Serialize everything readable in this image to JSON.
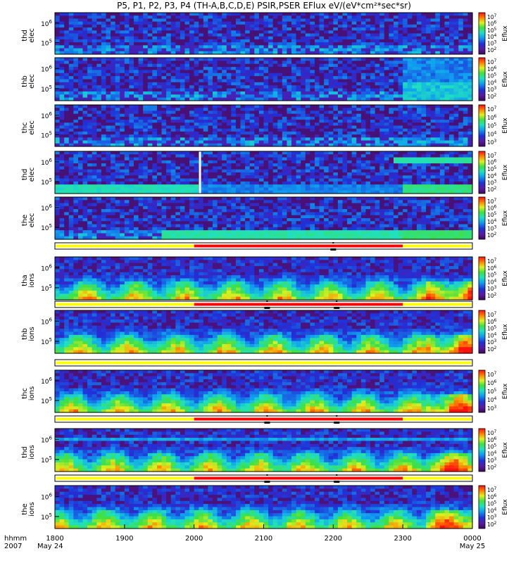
{
  "title": "P5, P1, P2, P3, P4 (TH-A,B,C,D,E) PSIR,PSER EFlux eV/(eV*cm²*sec*sr)",
  "chart_data": {
    "type": "heatmap",
    "title": "P5, P1, P2, P3, P4 (TH-A,B,C,D,E) PSIR,PSER EFlux eV/(eV*cm²*sec*sr)",
    "x_axis": {
      "label_line1": "hhmm",
      "label_line2": "2007",
      "ticks": [
        "1800",
        "1900",
        "2000",
        "2100",
        "2200",
        "2300",
        "0000"
      ],
      "date_labels": [
        "May 24",
        "May 25"
      ],
      "range": [
        "2007-05-24 18:00",
        "2007-05-25 00:00"
      ]
    },
    "colorbar": {
      "label": "Eflux",
      "scale": "log",
      "range": [
        100,
        10000000
      ],
      "tick_base": "10",
      "tick_exponents": [
        "7",
        "6",
        "5",
        "4",
        "3",
        "2"
      ]
    },
    "y_scale": "log",
    "panels": [
      {
        "id": "thd_elec",
        "probe": "thd",
        "species": "elec",
        "ylabel_line1": "thd",
        "ylabel_line2": "elec",
        "ytick_base": "10",
        "ytick_exponents": [
          "6",
          "5"
        ],
        "colorbar_exponents": [
          "7",
          "6",
          "5",
          "4",
          "3",
          "2"
        ]
      },
      {
        "id": "thb_elec",
        "probe": "thb",
        "species": "elec",
        "ylabel_line1": "thb",
        "ylabel_line2": "elec",
        "ytick_base": "10",
        "ytick_exponents": [
          "6",
          "5"
        ],
        "colorbar_exponents": [
          "7",
          "6",
          "5",
          "4",
          "3",
          "2"
        ]
      },
      {
        "id": "thc_elec",
        "probe": "thc",
        "species": "elec",
        "ylabel_line1": "thc",
        "ylabel_line2": "elec",
        "ytick_base": "10",
        "ytick_exponents": [
          "6",
          "5"
        ],
        "colorbar_exponents": [
          "7",
          "6",
          "5",
          "4",
          "3"
        ]
      },
      {
        "id": "thd_elec_2",
        "probe": "thd",
        "species": "elec",
        "ylabel_line1": "thd",
        "ylabel_line2": "elec",
        "ytick_base": "10",
        "ytick_exponents": [
          "6",
          "5"
        ],
        "colorbar_exponents": [
          "7",
          "6",
          "5",
          "4",
          "3",
          "2"
        ]
      },
      {
        "id": "the_elec",
        "probe": "the",
        "species": "elec",
        "ylabel_line1": "the",
        "ylabel_line2": "elec",
        "ytick_base": "10",
        "ytick_exponents": [
          "6",
          "5"
        ],
        "colorbar_exponents": [
          "7",
          "6",
          "5",
          "4",
          "3",
          "2"
        ]
      },
      {
        "id": "tha_ions",
        "probe": "tha",
        "species": "ions",
        "ylabel_line1": "tha",
        "ylabel_line2": "ions",
        "ytick_base": "10",
        "ytick_exponents": [
          "6",
          "5"
        ],
        "colorbar_exponents": [
          "7",
          "6",
          "5",
          "4",
          "3",
          "2"
        ]
      },
      {
        "id": "thb_ions",
        "probe": "thb",
        "species": "ions",
        "ylabel_line1": "thb",
        "ylabel_line2": "ions",
        "ytick_base": "10",
        "ytick_exponents": [
          "6",
          "5"
        ],
        "colorbar_exponents": [
          "7",
          "6",
          "5",
          "4",
          "3",
          "2"
        ]
      },
      {
        "id": "thc_ions",
        "probe": "thc",
        "species": "ions",
        "ylabel_line1": "thc",
        "ylabel_line2": "ions",
        "ytick_base": "10",
        "ytick_exponents": [
          "6",
          "5"
        ],
        "colorbar_exponents": [
          "7",
          "6",
          "5",
          "4",
          "3"
        ]
      },
      {
        "id": "thd_ions",
        "probe": "thd",
        "species": "ions",
        "ylabel_line1": "thd",
        "ylabel_line2": "ions",
        "ytick_base": "10",
        "ytick_exponents": [
          "6",
          "5"
        ],
        "colorbar_exponents": [
          "7",
          "6",
          "5",
          "4",
          "3",
          "2"
        ]
      },
      {
        "id": "the_ions",
        "probe": "the",
        "species": "ions",
        "ylabel_line1": "the",
        "ylabel_line2": "ions",
        "ytick_base": "10",
        "ytick_exponents": [
          "6",
          "5"
        ],
        "colorbar_exponents": [
          "7",
          "6",
          "5",
          "4",
          "3",
          "2"
        ]
      }
    ],
    "mode_bars": [
      {
        "after_panel": 4,
        "red_span_hours": [
          20.0,
          23.0
        ],
        "markers_hours": [
          22.0
        ]
      },
      {
        "after_panel": 5,
        "red_span_hours": [
          20.0,
          23.0
        ],
        "markers_hours": [
          21.05,
          22.05
        ]
      },
      {
        "after_panel": 6,
        "red_span_hours": [],
        "markers_hours": []
      },
      {
        "after_panel": 7,
        "red_span_hours": [
          20.0,
          23.0
        ],
        "markers_hours": [
          21.05,
          22.05
        ]
      },
      {
        "after_panel": 8,
        "red_span_hours": [
          20.0,
          23.0
        ],
        "markers_hours": [
          21.05,
          22.05
        ]
      }
    ],
    "mode_colors": {
      "fast": "#ff0000",
      "slow": "#ffff00"
    }
  }
}
